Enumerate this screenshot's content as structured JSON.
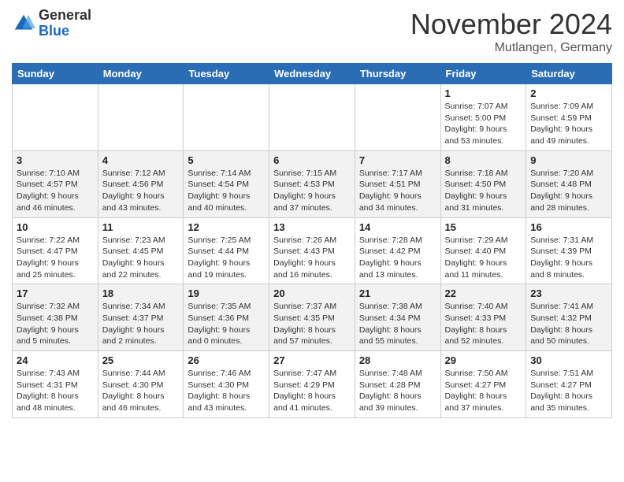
{
  "header": {
    "logo_general": "General",
    "logo_blue": "Blue",
    "month_title": "November 2024",
    "location": "Mutlangen, Germany"
  },
  "days_of_week": [
    "Sunday",
    "Monday",
    "Tuesday",
    "Wednesday",
    "Thursday",
    "Friday",
    "Saturday"
  ],
  "weeks": [
    [
      {
        "day": "",
        "info": ""
      },
      {
        "day": "",
        "info": ""
      },
      {
        "day": "",
        "info": ""
      },
      {
        "day": "",
        "info": ""
      },
      {
        "day": "",
        "info": ""
      },
      {
        "day": "1",
        "info": "Sunrise: 7:07 AM\nSunset: 5:00 PM\nDaylight: 9 hours and 53 minutes."
      },
      {
        "day": "2",
        "info": "Sunrise: 7:09 AM\nSunset: 4:59 PM\nDaylight: 9 hours and 49 minutes."
      }
    ],
    [
      {
        "day": "3",
        "info": "Sunrise: 7:10 AM\nSunset: 4:57 PM\nDaylight: 9 hours and 46 minutes."
      },
      {
        "day": "4",
        "info": "Sunrise: 7:12 AM\nSunset: 4:56 PM\nDaylight: 9 hours and 43 minutes."
      },
      {
        "day": "5",
        "info": "Sunrise: 7:14 AM\nSunset: 4:54 PM\nDaylight: 9 hours and 40 minutes."
      },
      {
        "day": "6",
        "info": "Sunrise: 7:15 AM\nSunset: 4:53 PM\nDaylight: 9 hours and 37 minutes."
      },
      {
        "day": "7",
        "info": "Sunrise: 7:17 AM\nSunset: 4:51 PM\nDaylight: 9 hours and 34 minutes."
      },
      {
        "day": "8",
        "info": "Sunrise: 7:18 AM\nSunset: 4:50 PM\nDaylight: 9 hours and 31 minutes."
      },
      {
        "day": "9",
        "info": "Sunrise: 7:20 AM\nSunset: 4:48 PM\nDaylight: 9 hours and 28 minutes."
      }
    ],
    [
      {
        "day": "10",
        "info": "Sunrise: 7:22 AM\nSunset: 4:47 PM\nDaylight: 9 hours and 25 minutes."
      },
      {
        "day": "11",
        "info": "Sunrise: 7:23 AM\nSunset: 4:45 PM\nDaylight: 9 hours and 22 minutes."
      },
      {
        "day": "12",
        "info": "Sunrise: 7:25 AM\nSunset: 4:44 PM\nDaylight: 9 hours and 19 minutes."
      },
      {
        "day": "13",
        "info": "Sunrise: 7:26 AM\nSunset: 4:43 PM\nDaylight: 9 hours and 16 minutes."
      },
      {
        "day": "14",
        "info": "Sunrise: 7:28 AM\nSunset: 4:42 PM\nDaylight: 9 hours and 13 minutes."
      },
      {
        "day": "15",
        "info": "Sunrise: 7:29 AM\nSunset: 4:40 PM\nDaylight: 9 hours and 11 minutes."
      },
      {
        "day": "16",
        "info": "Sunrise: 7:31 AM\nSunset: 4:39 PM\nDaylight: 9 hours and 8 minutes."
      }
    ],
    [
      {
        "day": "17",
        "info": "Sunrise: 7:32 AM\nSunset: 4:38 PM\nDaylight: 9 hours and 5 minutes."
      },
      {
        "day": "18",
        "info": "Sunrise: 7:34 AM\nSunset: 4:37 PM\nDaylight: 9 hours and 2 minutes."
      },
      {
        "day": "19",
        "info": "Sunrise: 7:35 AM\nSunset: 4:36 PM\nDaylight: 9 hours and 0 minutes."
      },
      {
        "day": "20",
        "info": "Sunrise: 7:37 AM\nSunset: 4:35 PM\nDaylight: 8 hours and 57 minutes."
      },
      {
        "day": "21",
        "info": "Sunrise: 7:38 AM\nSunset: 4:34 PM\nDaylight: 8 hours and 55 minutes."
      },
      {
        "day": "22",
        "info": "Sunrise: 7:40 AM\nSunset: 4:33 PM\nDaylight: 8 hours and 52 minutes."
      },
      {
        "day": "23",
        "info": "Sunrise: 7:41 AM\nSunset: 4:32 PM\nDaylight: 8 hours and 50 minutes."
      }
    ],
    [
      {
        "day": "24",
        "info": "Sunrise: 7:43 AM\nSunset: 4:31 PM\nDaylight: 8 hours and 48 minutes."
      },
      {
        "day": "25",
        "info": "Sunrise: 7:44 AM\nSunset: 4:30 PM\nDaylight: 8 hours and 46 minutes."
      },
      {
        "day": "26",
        "info": "Sunrise: 7:46 AM\nSunset: 4:30 PM\nDaylight: 8 hours and 43 minutes."
      },
      {
        "day": "27",
        "info": "Sunrise: 7:47 AM\nSunset: 4:29 PM\nDaylight: 8 hours and 41 minutes."
      },
      {
        "day": "28",
        "info": "Sunrise: 7:48 AM\nSunset: 4:28 PM\nDaylight: 8 hours and 39 minutes."
      },
      {
        "day": "29",
        "info": "Sunrise: 7:50 AM\nSunset: 4:27 PM\nDaylight: 8 hours and 37 minutes."
      },
      {
        "day": "30",
        "info": "Sunrise: 7:51 AM\nSunset: 4:27 PM\nDaylight: 8 hours and 35 minutes."
      }
    ]
  ]
}
